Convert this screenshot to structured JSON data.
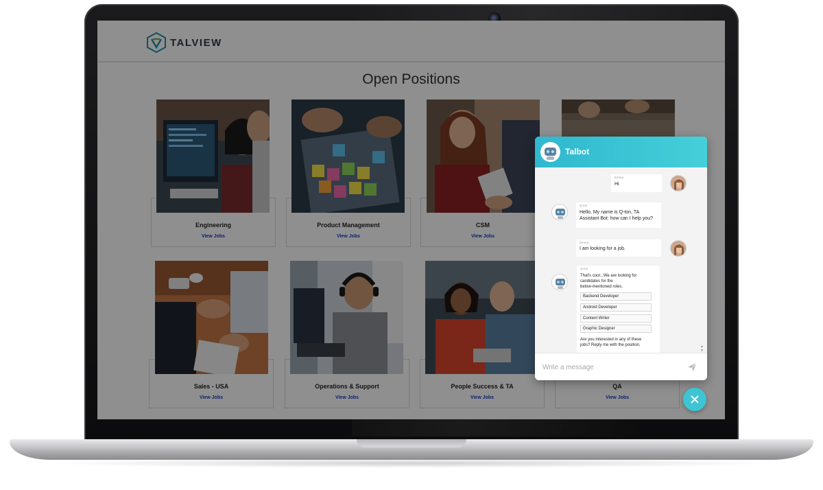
{
  "site": {
    "logo_text": "TALVIEW",
    "page_title": "Open Positions"
  },
  "cards": [
    {
      "title": "Engineering",
      "link": "View Jobs",
      "photo": "developer-at-computer"
    },
    {
      "title": "Product Management",
      "link": "View Jobs",
      "photo": "sticky-notes-planning"
    },
    {
      "title": "CSM",
      "link": "View Jobs",
      "photo": "handshake-smiling-woman"
    },
    {
      "title": "",
      "link": "",
      "photo": "team-at-table"
    },
    {
      "title": "Sales - USA",
      "link": "View Jobs",
      "photo": "business-handshake"
    },
    {
      "title": "Operations & Support",
      "link": "View Jobs",
      "photo": "support-agent-headset"
    },
    {
      "title": "People Success & TA",
      "link": "View Jobs",
      "photo": "colleagues-laptop"
    },
    {
      "title": "QA",
      "link": "View Jobs",
      "photo": "team-at-table"
    }
  ],
  "chat": {
    "title": "Talbot",
    "messages": [
      {
        "from": "user",
        "name": "Emma",
        "text": "Hi"
      },
      {
        "from": "bot",
        "name": "Q-ton",
        "text_lines": [
          "Hello, My name is Q-ton, TA",
          "Assistant Bot: how can I help you?"
        ]
      },
      {
        "from": "user",
        "name": "Emma",
        "text": "I am looking for a job."
      },
      {
        "from": "bot",
        "name": "Q-ton",
        "text_lines": [
          "That's cool...We are looking for",
          "candidates for the",
          "below-mentioned roles."
        ],
        "roles": [
          "Backend Developer",
          "Android Developer",
          "Content Writer",
          "Graphic Designer"
        ],
        "followup_lines": [
          "Are you interested in any of these",
          "jobs? Reply me with the position."
        ]
      }
    ],
    "input_placeholder": "Write a message",
    "send_icon": "paper-plane-icon",
    "close_icon": "close-icon"
  },
  "colors": {
    "accent": "#3ec5d3",
    "link": "#1a3cc6",
    "overlay": "rgba(0,0,0,0.44)"
  }
}
